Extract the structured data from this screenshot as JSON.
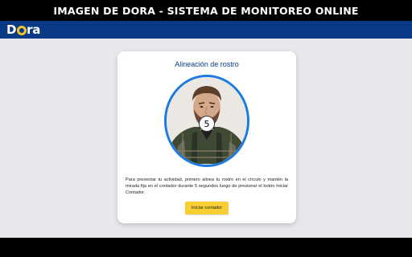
{
  "banner": {
    "title": "IMAGEN DE DORA - SISTEMA DE MONITOREO ONLINE"
  },
  "header": {
    "logo_text_left": "D",
    "logo_text_right": "ra"
  },
  "card": {
    "title": "Alineación de rostro",
    "counter": "5",
    "instructions": "Para presentar tu actividad, primero alinea tu rostro en el círculo y mantén la mirada fija en el contador durante 5 segundos luego de presionar el botón Iniciar Contador.",
    "button_label": "Iniciar contador"
  },
  "colors": {
    "header_bg": "#0a3a85",
    "title_color": "#0a3a85",
    "frame_border": "#1b7be0",
    "button_bg": "#f7cf34",
    "logo_accent": "#f2c12e",
    "page_bg": "#e7e7ec"
  }
}
